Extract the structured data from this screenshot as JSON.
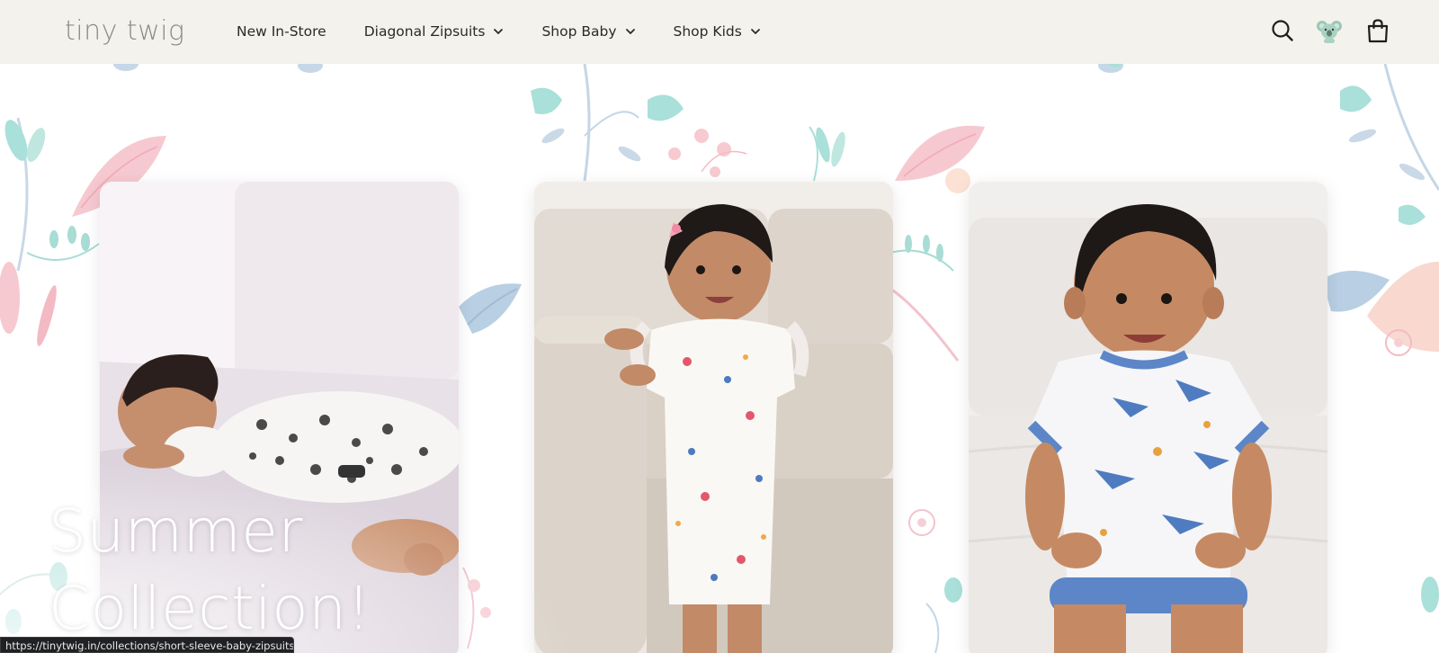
{
  "header": {
    "logo": "tiny twig",
    "nav": [
      {
        "label": "New In-Store",
        "has_dropdown": false
      },
      {
        "label": "Diagonal Zipsuits",
        "has_dropdown": true
      },
      {
        "label": "Shop Baby",
        "has_dropdown": true
      },
      {
        "label": "Shop Kids",
        "has_dropdown": true
      }
    ],
    "icons": [
      "search-icon",
      "koala-account-icon",
      "shopping-bag-icon"
    ]
  },
  "hero": {
    "title_line_1": "Summer",
    "title_line_2": "Collection!"
  },
  "cards": [
    {
      "image": "sleeping baby in farm-animal print zipsuit"
    },
    {
      "image": "standing baby girl in floral flutter-sleeve zipsuit"
    },
    {
      "image": "sitting baby in shark print zipsuit with blue trim"
    }
  ],
  "status_bar": {
    "url": "https://tinytwig.in/collections/short-sleeve-baby-zipsuits"
  },
  "colors": {
    "header_bg": "#f4f2ec",
    "logo": "#8b8b8b",
    "nav_text": "#2a2a2a",
    "leaf_blue": "#b9cfe3",
    "leaf_mint": "#9fdcd6",
    "leaf_pink": "#f3c3cc"
  }
}
